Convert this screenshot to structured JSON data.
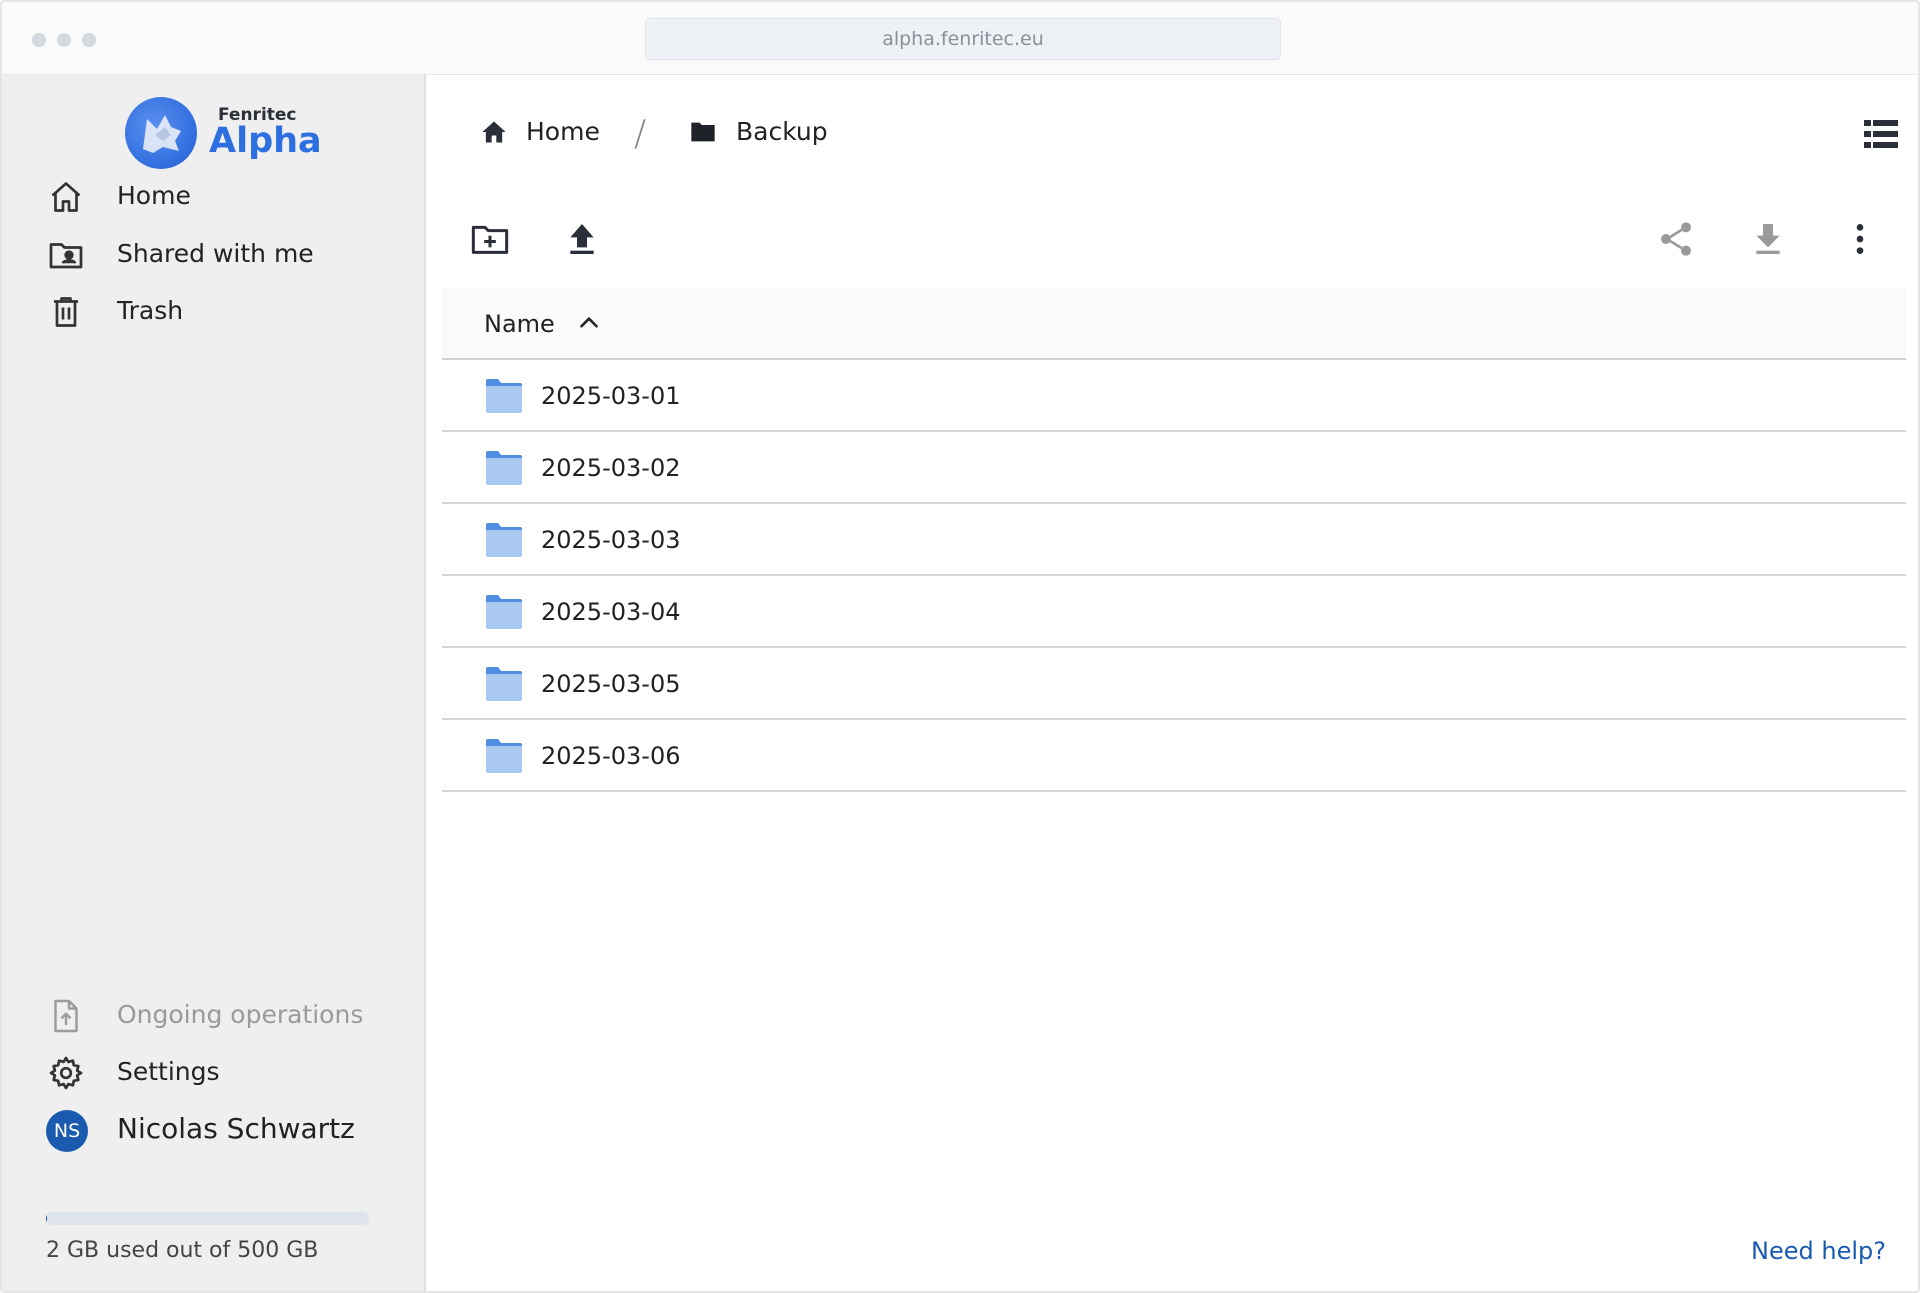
{
  "browser": {
    "url": "alpha.fenritec.eu"
  },
  "logo": {
    "small": "Fenritec",
    "big": "Alpha",
    "icon": "fenritec-wolf-logo"
  },
  "sidebar": {
    "items": [
      {
        "label": "Home",
        "icon": "home-icon"
      },
      {
        "label": "Shared with me",
        "icon": "shared-folder-icon"
      },
      {
        "label": "Trash",
        "icon": "trash-icon"
      }
    ],
    "bottom": {
      "operations": "Ongoing operations",
      "settings": "Settings",
      "user_name": "Nicolas Schwartz",
      "user_initials": "NS"
    },
    "storage": {
      "text": "2 GB used out of 500 GB",
      "used_fraction": 0.004
    }
  },
  "breadcrumb": {
    "home": "Home",
    "separator": "/",
    "current": "Backup"
  },
  "table": {
    "header": "Name",
    "sort": "ascending",
    "rows": [
      "2025-03-01",
      "2025-03-02",
      "2025-03-03",
      "2025-03-04",
      "2025-03-05",
      "2025-03-06"
    ]
  },
  "help": "Need help?",
  "colors": {
    "accent": "#1a5bb0",
    "folder": "#a9c8ef",
    "folder_tab": "#4f8ee0"
  }
}
